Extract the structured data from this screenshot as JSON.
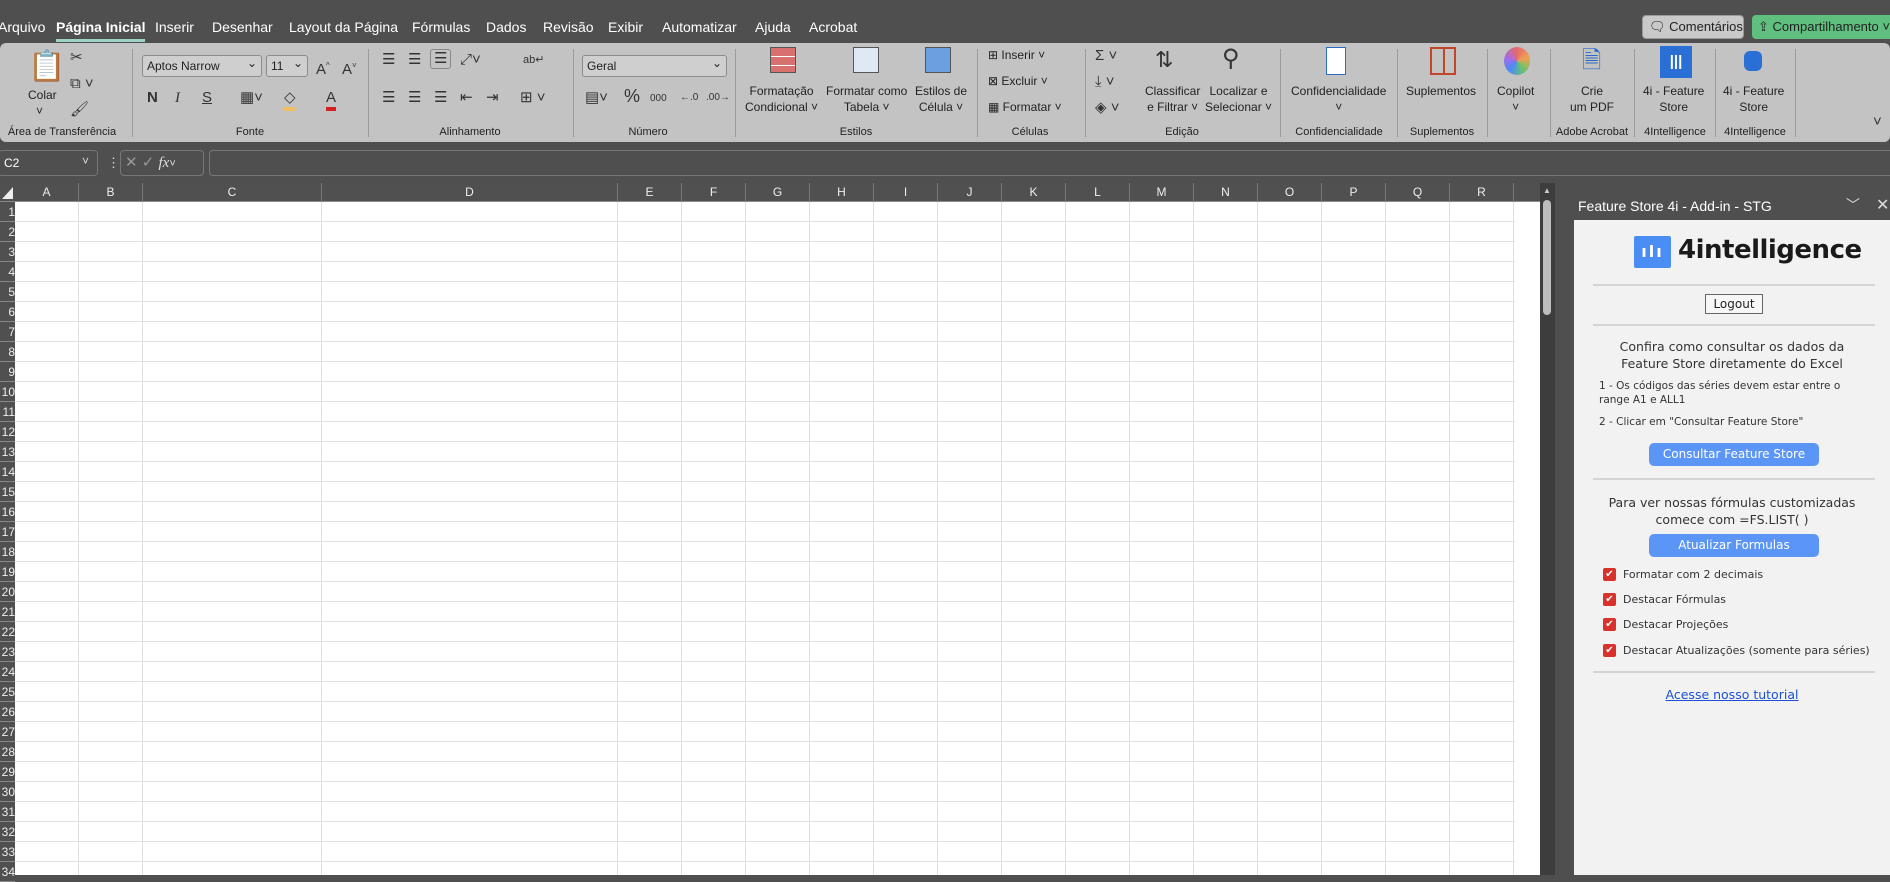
{
  "tabs": [
    "Arquivo",
    "Página Inicial",
    "Inserir",
    "Desenhar",
    "Layout da Página",
    "Fórmulas",
    "Dados",
    "Revisão",
    "Exibir",
    "Automatizar",
    "Ajuda",
    "Acrobat"
  ],
  "active_tab": "Página Inicial",
  "comments_label": "Comentários",
  "share_label": "Compartilhamento",
  "ribbon": {
    "paste": "Colar",
    "font_name": "Aptos Narrow",
    "font_size": "11",
    "bold": "N",
    "italic": "I",
    "underline": "S",
    "number_format": "Geral",
    "cond_format": [
      "Formatação",
      "Condicional ˅"
    ],
    "format_table": [
      "Formatar como",
      "Tabela ˅"
    ],
    "cell_styles": [
      "Estilos de",
      "Célula ˅"
    ],
    "insert": "Inserir",
    "delete": "Excluir",
    "format": "Formatar ˅",
    "sort": [
      "Classificar",
      "e Filtrar ˅"
    ],
    "find": [
      "Localizar e",
      "Selecionar ˅"
    ],
    "confidentiality": "Confidencialidade",
    "addins": "Suplementos",
    "copilot": "Copilot",
    "pdf": [
      "Crie",
      "um PDF"
    ],
    "fs1": [
      "4i - Feature",
      "Store"
    ],
    "fs2": [
      "4i - Feature",
      "Store"
    ],
    "groups": [
      "Área de Transferência",
      "Fonte",
      "Alinhamento",
      "Número",
      "Estilos",
      "Células",
      "Edição",
      "Confidencialidade",
      "Suplementos",
      "Adobe Acrobat",
      "4Intelligence",
      "4Intelligence"
    ]
  },
  "name_box": "C2",
  "formula": "",
  "columns": [
    "A",
    "B",
    "C",
    "D",
    "E",
    "F",
    "G",
    "H",
    "I",
    "J",
    "K",
    "L",
    "M",
    "N",
    "O",
    "P",
    "Q",
    "R"
  ],
  "rows": [
    "1",
    "2",
    "3",
    "4",
    "5",
    "6",
    "7",
    "8",
    "9",
    "10",
    "11",
    "12",
    "13",
    "14",
    "15",
    "16",
    "17",
    "18",
    "19",
    "20",
    "21",
    "22",
    "23",
    "24",
    "25",
    "26",
    "27",
    "28",
    "29",
    "30",
    "31",
    "32",
    "33",
    "34"
  ],
  "panel": {
    "title": "Feature Store 4i - Add-in - STG",
    "logo_text": "4intelligence",
    "logout": "Logout",
    "intro": [
      "Confira como consultar os dados da",
      "Feature Store diretamente do Excel"
    ],
    "step1": [
      "1 - Os códigos das séries devem estar entre o",
      "range A1 e ALL1"
    ],
    "step2": "2 - Clicar em \"Consultar Feature Store\"",
    "consult_button": "Consultar Feature Store",
    "formulas_text": [
      "Para ver nossas fórmulas customizadas",
      "comece com =FS.LIST( )"
    ],
    "update_button": "Atualizar Formulas",
    "options": [
      {
        "label": "Formatar com 2 decimais",
        "checked": true
      },
      {
        "label": "Destacar Fórmulas",
        "checked": true
      },
      {
        "label": "Destacar Projeções",
        "checked": true
      },
      {
        "label": "Destacar Atualizações (somente para séries)",
        "checked": true
      }
    ],
    "tutorial_link": "Acesse nosso tutorial"
  },
  "colors": {
    "accent": "#5b96f7",
    "share": "#5fbf7f",
    "check": "#d9312b",
    "logo": "#4a8df5"
  }
}
